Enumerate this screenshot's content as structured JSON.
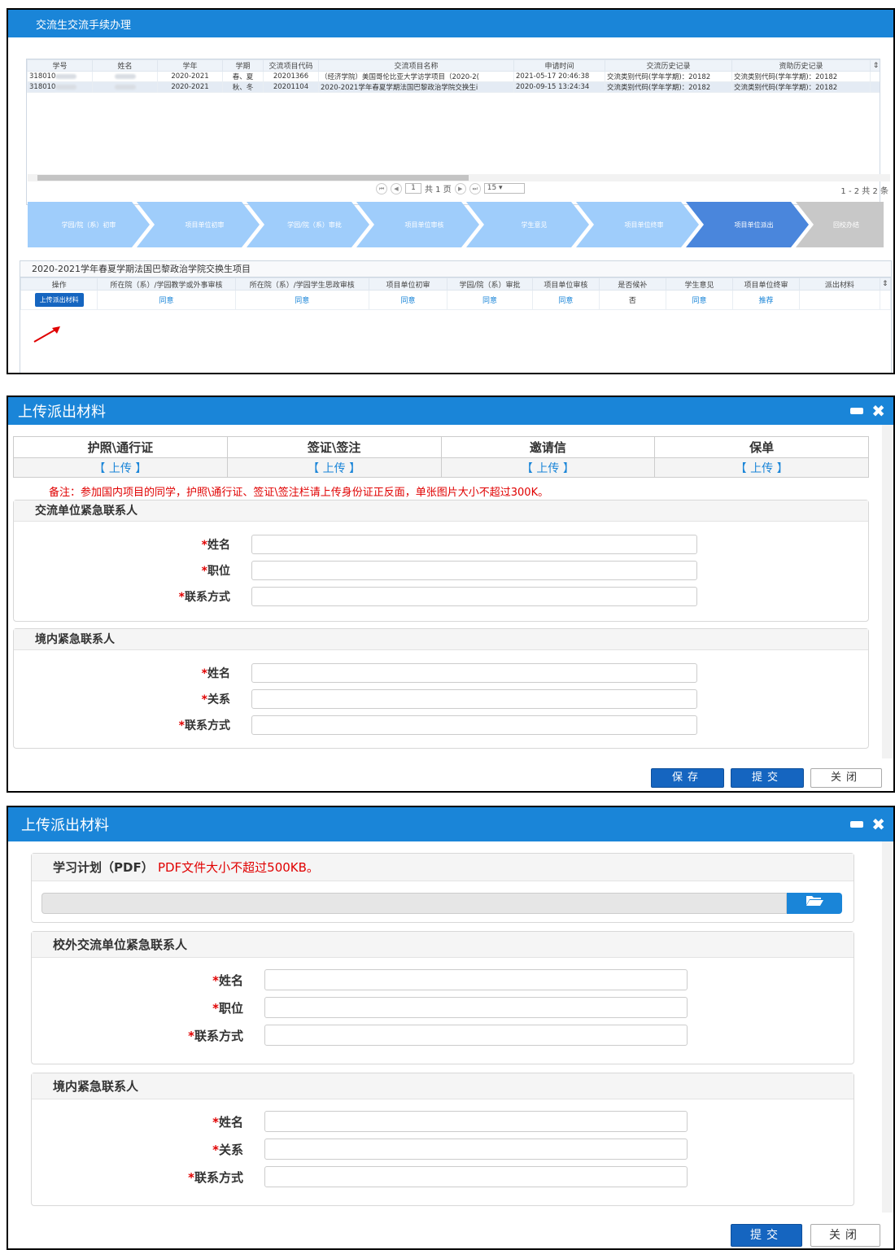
{
  "panel1": {
    "title": "交流生交流手续办理",
    "grid": {
      "headers": [
        "学号",
        "姓名",
        "学年",
        "学期",
        "交流项目代码",
        "交流项目名称",
        "申请时间",
        "交流历史记录",
        "资助历史记录"
      ],
      "rows": [
        {
          "id": "318010",
          "year": "2020-2021",
          "term": "春、夏",
          "code": "20201366",
          "project": "（经济学院）美国哥伦比亚大学访学项目（2020-2(",
          "time": "2021-05-17 20:46:38",
          "history": "交流类别代码(学年学期)：20182",
          "funding": "交流类别代码(学年学期)：20182"
        },
        {
          "id": "318010",
          "year": "2020-2021",
          "term": "秋、冬",
          "code": "20201104",
          "project": "2020-2021学年春夏学期法国巴黎政治学院交换生i",
          "time": "2020-09-15 13:24:34",
          "history": "交流类别代码(学年学期)：20182",
          "funding": "交流类别代码(学年学期)：20182"
        }
      ]
    },
    "pager": {
      "page": "1",
      "total_pages": "共 1 页",
      "page_size": "15",
      "count": "1 - 2  共 2 条"
    },
    "steps": [
      "学园/院（系）初审",
      "项目单位初审",
      "学园/院（系）审批",
      "项目单位审核",
      "学生意见",
      "项目单位终审",
      "项目单位派出",
      "回校办结"
    ],
    "project": {
      "title": "2020-2021学年春夏学期法国巴黎政治学院交换生项目",
      "headers": [
        "操作",
        "所在院（系）/学园教学或外事审核",
        "所在院（系）/学园学生思政审核",
        "项目单位初审",
        "学园/院（系）审批",
        "项目单位审核",
        "是否候补",
        "学生意见",
        "项目单位终审",
        "派出材料"
      ],
      "upload_label": "上传派出材料",
      "values": [
        "同意",
        "同意",
        "同意",
        "同意",
        "同意",
        "否",
        "同意",
        "推荐"
      ]
    }
  },
  "panel2": {
    "title": "上传派出材料",
    "uploads": {
      "headers": [
        "护照\\通行证",
        "签证\\签注",
        "邀请信",
        "保单"
      ],
      "action": "【 上传 】"
    },
    "note": "备注：参加国内项目的同学，护照\\通行证、签证\\签注栏请上传身份证正反面，单张图片大小不超过300K。",
    "section1": {
      "title": "交流单位紧急联系人",
      "fields": [
        "姓名",
        "职位",
        "联系方式"
      ]
    },
    "section2": {
      "title": "境内紧急联系人",
      "fields": [
        "姓名",
        "关系",
        "联系方式"
      ]
    },
    "buttons": {
      "save": "保存",
      "submit": "提交",
      "close": "关闭"
    }
  },
  "panel3": {
    "title": "上传派出材料",
    "pdf_label": "学习计划（PDF）",
    "pdf_note": "PDF文件大小不超过500KB。",
    "section1": {
      "title": "校外交流单位紧急联系人",
      "fields": [
        "姓名",
        "职位",
        "联系方式"
      ]
    },
    "section2": {
      "title": "境内紧急联系人",
      "fields": [
        "姓名",
        "关系",
        "联系方式"
      ]
    },
    "buttons": {
      "submit": "提交",
      "close": "关闭"
    }
  },
  "icons": {
    "required": "*",
    "folder": "folder-open-icon"
  },
  "colors": {
    "header": "#1a85d8",
    "button": "#1565c0",
    "step_light": "#9fcdfb",
    "step_active": "#4a86dc",
    "step_gray": "#c8c8c8",
    "note": "#e00000"
  }
}
